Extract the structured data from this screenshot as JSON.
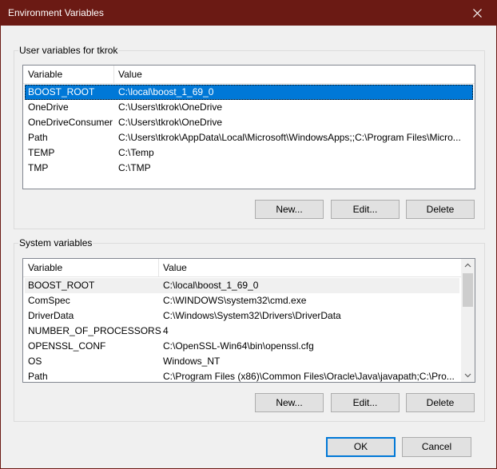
{
  "window": {
    "title": "Environment Variables"
  },
  "user_vars": {
    "label": "User variables for tkrok",
    "headers": [
      "Variable",
      "Value"
    ],
    "rows": [
      {
        "name": "BOOST_ROOT",
        "value": "C:\\local\\boost_1_69_0",
        "selected": true
      },
      {
        "name": "OneDrive",
        "value": "C:\\Users\\tkrok\\OneDrive"
      },
      {
        "name": "OneDriveConsumer",
        "value": "C:\\Users\\tkrok\\OneDrive"
      },
      {
        "name": "Path",
        "value": "C:\\Users\\tkrok\\AppData\\Local\\Microsoft\\WindowsApps;;C:\\Program Files\\Micro..."
      },
      {
        "name": "TEMP",
        "value": "C:\\Temp"
      },
      {
        "name": "TMP",
        "value": "C:\\TMP"
      }
    ],
    "buttons": {
      "new": "New...",
      "edit": "Edit...",
      "delete": "Delete"
    }
  },
  "system_vars": {
    "label": "System variables",
    "headers": [
      "Variable",
      "Value"
    ],
    "rows": [
      {
        "name": "BOOST_ROOT",
        "value": "C:\\local\\boost_1_69_0",
        "highlighted": true
      },
      {
        "name": "ComSpec",
        "value": "C:\\WINDOWS\\system32\\cmd.exe"
      },
      {
        "name": "DriverData",
        "value": "C:\\Windows\\System32\\Drivers\\DriverData"
      },
      {
        "name": "NUMBER_OF_PROCESSORS",
        "value": "4"
      },
      {
        "name": "OPENSSL_CONF",
        "value": "C:\\OpenSSL-Win64\\bin\\openssl.cfg"
      },
      {
        "name": "OS",
        "value": "Windows_NT"
      },
      {
        "name": "Path",
        "value": "C:\\Program Files (x86)\\Common Files\\Oracle\\Java\\javapath;C:\\Pro..."
      }
    ],
    "buttons": {
      "new": "New...",
      "edit": "Edit...",
      "delete": "Delete"
    }
  },
  "footer": {
    "ok": "OK",
    "cancel": "Cancel"
  },
  "colors": {
    "titlebar": "#6b1a14",
    "selection": "#0078d7"
  }
}
